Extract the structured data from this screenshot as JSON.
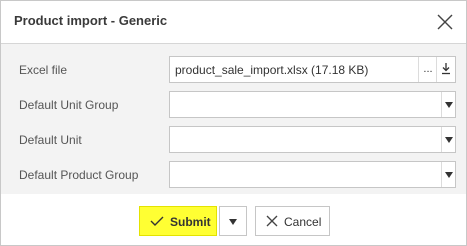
{
  "dialog": {
    "title": "Product import - Generic",
    "close_icon": "close-icon"
  },
  "fields": [
    {
      "label": "Excel file",
      "value": "product_sale_import.xlsx (17.18 KB)",
      "more_label": "...",
      "download_icon": "download-icon"
    },
    {
      "label": "Default Unit Group",
      "value": ""
    },
    {
      "label": "Default Unit",
      "value": ""
    },
    {
      "label": "Default Product Group",
      "value": ""
    }
  ],
  "footer": {
    "submit_label": "Submit",
    "submit_icon": "check-icon",
    "submit_color": "#ffff33",
    "cancel_label": "Cancel",
    "cancel_icon": "close-icon"
  }
}
